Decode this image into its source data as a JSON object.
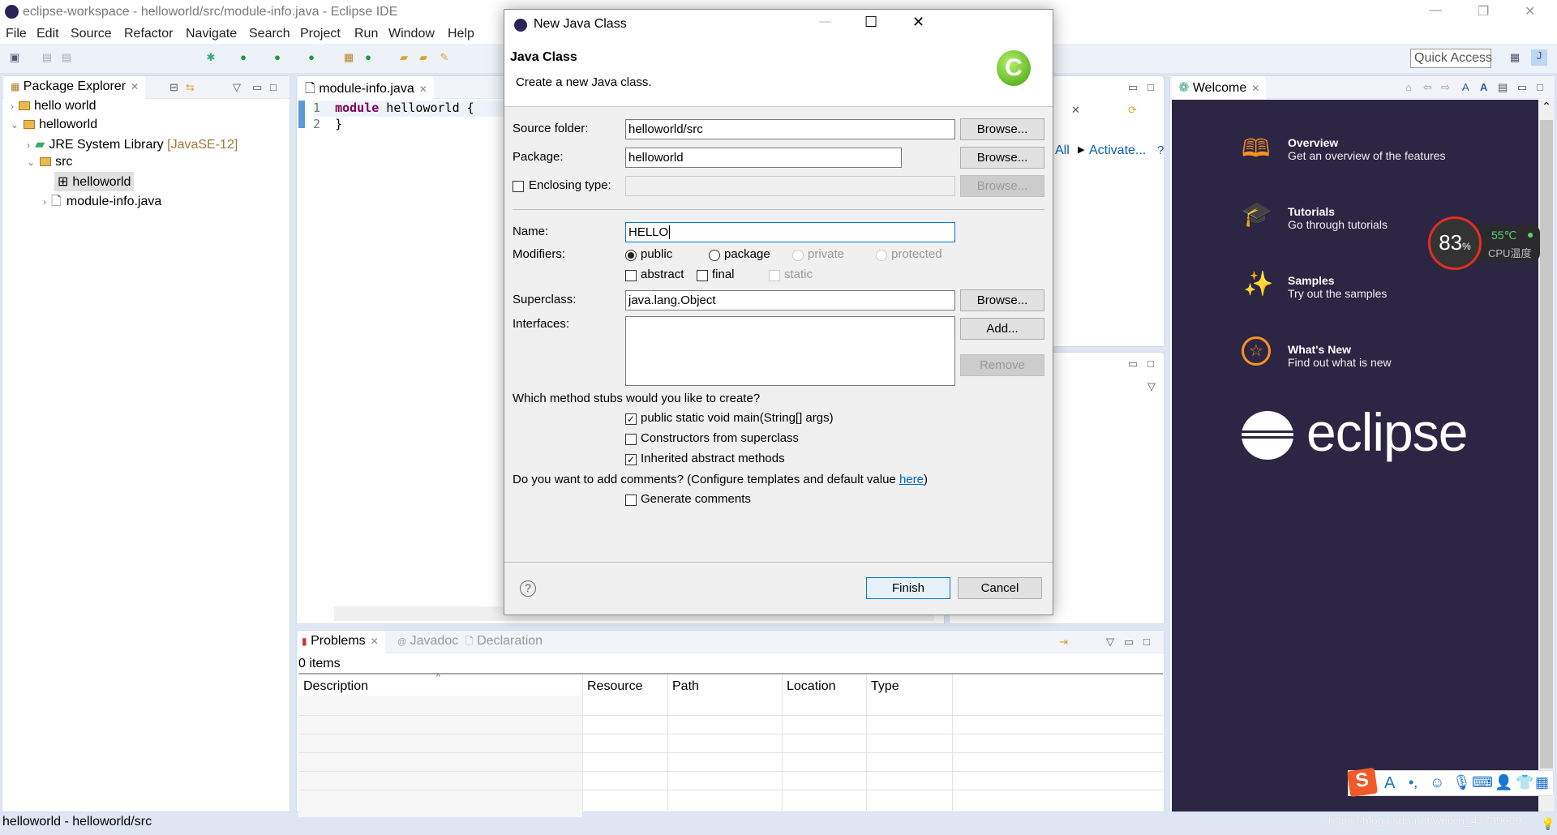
{
  "window": {
    "title": "eclipse-workspace - helloworld/src/module-info.java - Eclipse IDE"
  },
  "menu": [
    "File",
    "Edit",
    "Source",
    "Refactor",
    "Navigate",
    "Search",
    "Project",
    "Run",
    "Window",
    "Help"
  ],
  "toolbar": {
    "quick_access": "Quick Access"
  },
  "package_explorer": {
    "tab": "Package Explorer",
    "tree": [
      {
        "label": "hello world",
        "expanded": false
      },
      {
        "label": "helloworld",
        "expanded": true
      },
      {
        "label": "JRE System Library",
        "suffix": "[JavaSE-12]",
        "expanded": false
      },
      {
        "label": "src",
        "expanded": true
      },
      {
        "label": "helloworld",
        "selected": true
      },
      {
        "label": "module-info.java",
        "expanded": false
      }
    ]
  },
  "editor": {
    "tab": "module-info.java",
    "lines": [
      {
        "num": "1",
        "keyword": "module",
        "rest": " helloworld {"
      },
      {
        "num": "2",
        "keyword": "",
        "rest": "}"
      }
    ]
  },
  "hidden_panel": {
    "all": "All",
    "activate": "Activate..."
  },
  "welcome": {
    "tab": "Welcome",
    "items": [
      {
        "title": "Overview",
        "desc": "Get an overview of the features",
        "icon": "map-icon"
      },
      {
        "title": "Tutorials",
        "desc": "Go through tutorials",
        "icon": "graduation-cap-icon"
      },
      {
        "title": "Samples",
        "desc": "Try out the samples",
        "icon": "magic-wand-icon"
      },
      {
        "title": "What's New",
        "desc": "Find out what is new",
        "icon": "star-icon"
      }
    ],
    "logo": "eclipse"
  },
  "cpu_widget": {
    "percent": "83",
    "percent_sign": "%",
    "temp": "55℃",
    "label": "CPU温度"
  },
  "problems": {
    "tabs": [
      "Problems",
      "Javadoc",
      "Declaration"
    ],
    "count": "0 items",
    "columns": [
      "Description",
      "Resource",
      "Path",
      "Location",
      "Type"
    ]
  },
  "status": {
    "text": "helloworld - helloworld/src",
    "watermark": "https://blog.csdn.net/weixin_43739609"
  },
  "dialog": {
    "title": "New Java Class",
    "header": "Java Class",
    "subtitle": "Create a new Java class.",
    "source_folder": {
      "label": "Source folder:",
      "value": "helloworld/src",
      "button": "Browse..."
    },
    "package": {
      "label": "Package:",
      "value": "helloworld",
      "button": "Browse..."
    },
    "enclosing": {
      "label": "Enclosing type:",
      "value": "",
      "button": "Browse...",
      "checked": false
    },
    "name": {
      "label": "Name:",
      "value": "HELLO"
    },
    "modifiers": {
      "label": "Modifiers:",
      "radios": [
        "public",
        "package",
        "private",
        "protected"
      ],
      "selected": "public",
      "checks": [
        "abstract",
        "final",
        "static"
      ]
    },
    "superclass": {
      "label": "Superclass:",
      "value": "java.lang.Object",
      "button": "Browse..."
    },
    "interfaces": {
      "label": "Interfaces:",
      "add": "Add...",
      "remove": "Remove"
    },
    "stubs": {
      "question": "Which method stubs would you like to create?",
      "options": [
        {
          "label": "public static void main(String[] args)",
          "checked": true
        },
        {
          "label": "Constructors from superclass",
          "checked": false
        },
        {
          "label": "Inherited abstract methods",
          "checked": true
        }
      ]
    },
    "comments": {
      "question": "Do you want to add comments? (Configure templates and default value ",
      "link": "here",
      "close": ")",
      "option": "Generate comments",
      "checked": false
    },
    "finish": "Finish",
    "cancel": "Cancel"
  },
  "colors": {
    "welcome_bg": "#2c2543",
    "accent_orange": "#f7941e",
    "link": "#0066cc",
    "focus": "#0078d7"
  }
}
